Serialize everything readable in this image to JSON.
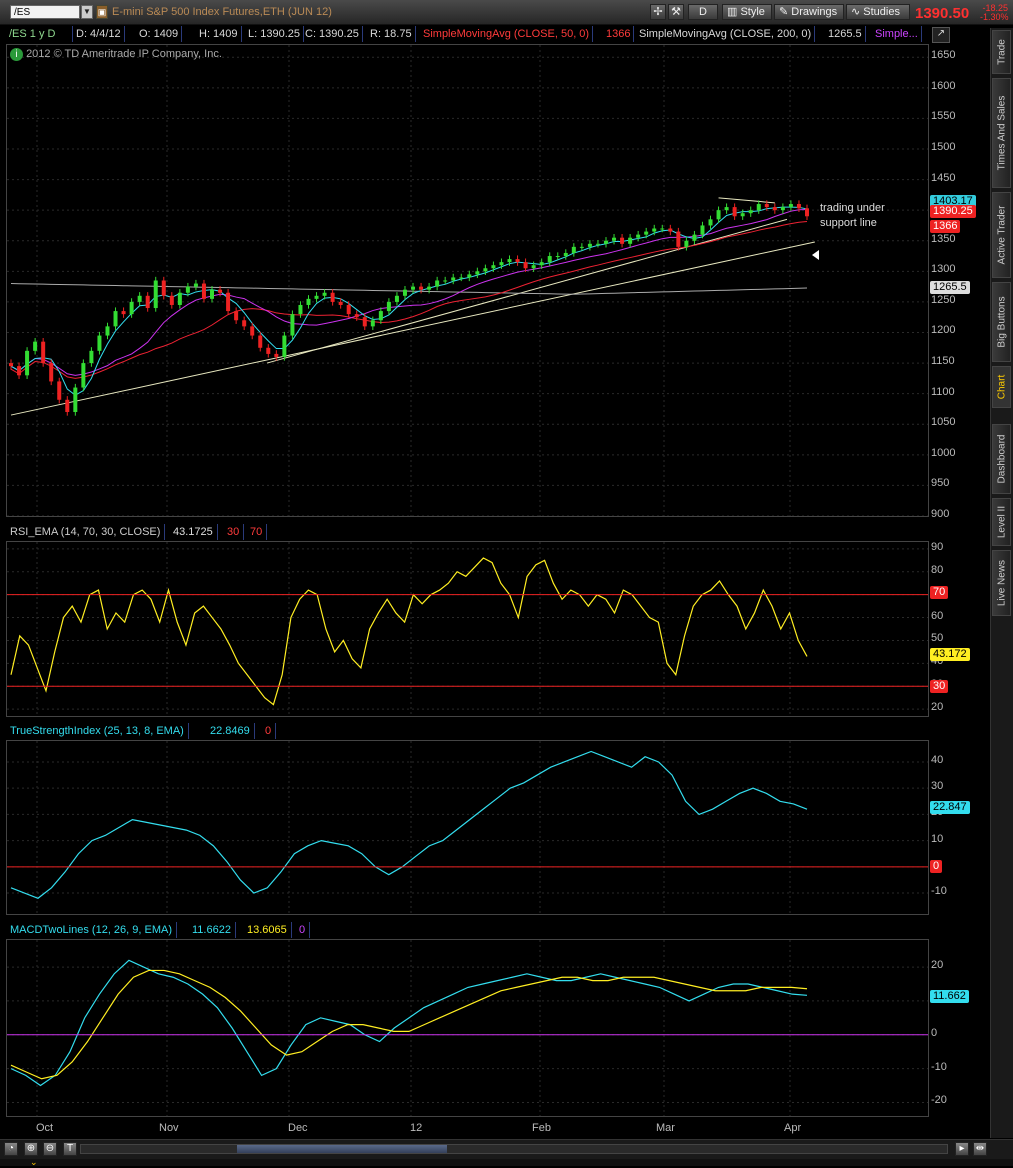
{
  "colors": {
    "up": "#33dd33",
    "down": "#ee2222",
    "rsi": "#ffee22",
    "tsi": "#33ddee",
    "sma50": "#ee2233",
    "sma200": "#cc33ee",
    "support": "#e8e8c0",
    "ma_gray": "#aaaaaa"
  },
  "topbar": {
    "symbol": "/ES",
    "description": "E-mini S&P 500 Index Futures,ETH (JUN 12)",
    "d_label": "D",
    "style_label": "Style",
    "drawings_label": "Drawings",
    "studies_label": "Studies",
    "last_price": "1390.50",
    "change": "-18.25",
    "change_pct": "-1.30%"
  },
  "infobar": {
    "symbol_period": "/ES 1 y D",
    "date": "D: 4/4/12",
    "open": "O: 1409",
    "high": "H: 1409",
    "low": "L: 1390.25",
    "close": "C: 1390.25",
    "range": "R: 18.75",
    "sma50_label": "SimpleMovingAvg (CLOSE, 50, 0)",
    "sma50_value": "1366",
    "sma200_label": "SimpleMovingAvg (CLOSE, 200, 0)",
    "sma200_value": "1265.5",
    "simple_more": "Simple..."
  },
  "copyright": "2012 © TD Ameritrade IP Company, Inc.",
  "annotation": {
    "line1": "trading under",
    "line2": "support line"
  },
  "price_axis": {
    "ticks": [
      "1650",
      "1600",
      "1550",
      "1500",
      "1450",
      "1400",
      "1350",
      "1300",
      "1250",
      "1200",
      "1150",
      "1100",
      "1050",
      "1000",
      "950",
      "900"
    ],
    "tags": {
      "high": "1403.17",
      "last": "1390.25",
      "sma50": "1366",
      "sma200": "1265.5"
    }
  },
  "rsi": {
    "label": "RSI_EMA (14, 70, 30, CLOSE)",
    "value": "43.1725",
    "low": "30",
    "high": "70",
    "ticks": [
      "90",
      "80",
      "70",
      "60",
      "50",
      "40",
      "30",
      "20"
    ],
    "tag": "43.172",
    "tag30": "30",
    "tag70": "70"
  },
  "tsi": {
    "label": "TrueStrengthIndex (25, 13, 8, EMA)",
    "value": "22.8469",
    "zero": "0",
    "ticks": [
      "40",
      "30",
      "20",
      "10",
      "0",
      "-10"
    ],
    "tag": "22.847",
    "tag0": "0"
  },
  "macd": {
    "label": "MACDTwoLines (12, 26, 9, EMA)",
    "value": "11.6622",
    "avg": "13.6065",
    "zero": "0",
    "ticks": [
      "20",
      "10",
      "0",
      "-10",
      "-20"
    ],
    "tag": "11.662"
  },
  "xaxis": {
    "labels": [
      "Oct",
      "Nov",
      "Dec",
      "12",
      "Feb",
      "Mar",
      "Apr"
    ]
  },
  "sidetabs": [
    "Trade",
    "Times And Sales",
    "Active Trader",
    "Big Buttons",
    "Chart",
    "Dashboard",
    "Level II",
    "Live News"
  ],
  "chart_data": {
    "type": "candlestick",
    "x_labels": [
      "Oct",
      "Nov",
      "Dec",
      "12",
      "Feb",
      "Mar",
      "Apr"
    ],
    "price_range": [
      900,
      1670
    ],
    "closes": [
      1145,
      1130,
      1170,
      1185,
      1150,
      1120,
      1090,
      1070,
      1110,
      1150,
      1170,
      1195,
      1210,
      1235,
      1230,
      1250,
      1260,
      1240,
      1285,
      1260,
      1245,
      1265,
      1275,
      1280,
      1255,
      1270,
      1265,
      1235,
      1220,
      1210,
      1195,
      1175,
      1165,
      1160,
      1195,
      1230,
      1245,
      1255,
      1260,
      1265,
      1250,
      1245,
      1230,
      1225,
      1210,
      1220,
      1235,
      1250,
      1260,
      1270,
      1275,
      1270,
      1275,
      1285,
      1285,
      1290,
      1290,
      1295,
      1300,
      1305,
      1310,
      1315,
      1320,
      1315,
      1305,
      1310,
      1315,
      1325,
      1325,
      1330,
      1340,
      1340,
      1345,
      1345,
      1350,
      1355,
      1345,
      1355,
      1360,
      1365,
      1370,
      1370,
      1365,
      1340,
      1350,
      1360,
      1375,
      1385,
      1400,
      1405,
      1390,
      1395,
      1400,
      1410,
      1405,
      1400,
      1405,
      1410,
      1403,
      1390
    ],
    "support_line": [
      [
        0,
        1065
      ],
      [
        95,
        1348
      ]
    ],
    "upper_line": [
      [
        88,
        1420
      ],
      [
        95,
        1412
      ]
    ],
    "rsi_values": [
      35,
      52,
      48,
      38,
      28,
      45,
      60,
      65,
      58,
      70,
      72,
      55,
      62,
      58,
      70,
      72,
      68,
      58,
      72,
      58,
      48,
      62,
      65,
      60,
      55,
      48,
      40,
      35,
      30,
      25,
      22,
      35,
      60,
      68,
      72,
      70,
      55,
      45,
      50,
      42,
      38,
      55,
      62,
      68,
      62,
      58,
      70,
      66,
      70,
      72,
      75,
      80,
      78,
      82,
      86,
      84,
      75,
      70,
      60,
      78,
      83,
      85,
      75,
      68,
      72,
      70,
      65,
      70,
      68,
      62,
      72,
      70,
      65,
      60,
      58,
      40,
      35,
      52,
      65,
      70,
      72,
      76,
      70,
      65,
      55,
      62,
      72,
      65,
      55,
      62,
      50,
      43
    ],
    "tsi_values": [
      -8,
      -10,
      -12,
      -8,
      -2,
      5,
      10,
      12,
      15,
      18,
      17,
      16,
      15,
      14,
      12,
      8,
      2,
      -5,
      -10,
      -8,
      -2,
      5,
      8,
      10,
      9,
      8,
      5,
      0,
      -3,
      0,
      4,
      8,
      10,
      14,
      18,
      22,
      26,
      30,
      32,
      35,
      38,
      40,
      42,
      44,
      42,
      40,
      38,
      42,
      40,
      35,
      25,
      20,
      22,
      25,
      28,
      30,
      28,
      25,
      24,
      22
    ],
    "macd_values": [
      -10,
      -12,
      -15,
      -12,
      -5,
      5,
      12,
      18,
      22,
      20,
      18,
      17,
      15,
      12,
      8,
      2,
      -5,
      -12,
      -10,
      -3,
      3,
      5,
      4,
      3,
      0,
      -2,
      2,
      5,
      8,
      10,
      12,
      14,
      15,
      16,
      17,
      18,
      17,
      16,
      16,
      17,
      18,
      17,
      16,
      15,
      14,
      12,
      10,
      12,
      14,
      15,
      15,
      14,
      13,
      12,
      11.66
    ],
    "macd_avg": [
      -9,
      -11,
      -13,
      -12,
      -8,
      -2,
      5,
      12,
      17,
      19,
      19,
      18,
      16,
      14,
      11,
      7,
      2,
      -3,
      -6,
      -5,
      -2,
      1,
      3,
      3,
      2,
      1,
      1,
      3,
      5,
      7,
      9,
      11,
      13,
      14,
      15,
      16,
      17,
      17,
      16,
      16,
      17,
      17,
      17,
      16,
      15,
      14,
      13,
      13,
      13,
      14,
      14,
      14,
      13.6
    ]
  }
}
